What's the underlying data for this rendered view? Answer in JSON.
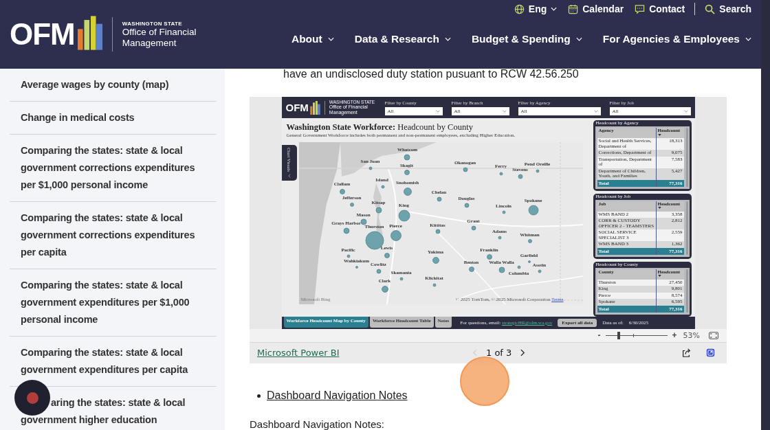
{
  "header": {
    "logo": {
      "letters": "OFM",
      "state": "WASHINGTON STATE",
      "line1": "Office of Financial",
      "line2": "Management"
    },
    "utility": [
      {
        "kind": "language",
        "label": "Eng",
        "caret": true
      },
      {
        "kind": "calendar",
        "label": "Calendar",
        "caret": false
      },
      {
        "kind": "contact",
        "label": "Contact",
        "caret": false
      },
      {
        "kind": "search",
        "label": "Search",
        "caret": false
      }
    ],
    "nav": [
      {
        "label": "About"
      },
      {
        "label": "Data & Research"
      },
      {
        "label": "Budget & Spending"
      },
      {
        "label": "For Agencies & Employees"
      }
    ]
  },
  "sidebar": {
    "items": [
      {
        "label": "Average wages by county (map)"
      },
      {
        "label": "Change in medical costs"
      },
      {
        "label": "Comparing the states: state & local government corrections expenditures per $1,000 personal income"
      },
      {
        "label": "Comparing the states: state & local government corrections expenditures per capita"
      },
      {
        "label": "Comparing the states: state & local government expenditures per $1,000 personal income"
      },
      {
        "label": "Comparing the states: state & local government expenditures per capita"
      },
      {
        "label": "aring the states: state & local government higher education"
      }
    ]
  },
  "main": {
    "intro": "have an undisclosed duty station pusuant to RCW 42.56.250",
    "report": {
      "logo": {
        "letters": "OFM",
        "state": "WASHINGTON STATE",
        "line1": "Office of Financial",
        "line2": "Management"
      },
      "filters": [
        {
          "label": "Filter by County",
          "value": "All"
        },
        {
          "label": "Filter by Branch",
          "value": "All"
        },
        {
          "label": "Filter by Agency",
          "value": "All"
        },
        {
          "label": "Filter by Job",
          "value": "All"
        }
      ],
      "title": "**Washington State Workforce:** Headcount by County",
      "subtitle": "General Government Workforce includes both permanent and non-permanent employees, excluding Higher Education.",
      "side_tab": "Chart Visuals",
      "map": {
        "counties": [
          "Whatcom",
          "San Juan",
          "Skagit",
          "Okanogan",
          "Ferry",
          "Stevens",
          "Pend Oreille",
          "Island",
          "Snohomish",
          "Clallam",
          "Jefferson",
          "Chelan",
          "Douglas",
          "Kitsap",
          "King",
          "Lincoln",
          "Spokane",
          "Mason",
          "Grays Harbor",
          "Thurston",
          "Pierce",
          "Grant",
          "Kittitas",
          "Adams",
          "Whitman",
          "Lewis",
          "Pacific",
          "Wahkiakum",
          "Cowlitz",
          "Yakima",
          "Franklin",
          "Benton",
          "Garfield",
          "Walla Walla",
          "Asotin",
          "Columbia",
          "Skamania",
          "Klickitat",
          "Clark"
        ],
        "bing": "Microsoft Bing",
        "attribution": "© 2025 TomTom, © 2025 Microsoft Corporation",
        "terms": "Terms"
      },
      "tables": [
        {
          "title": "Headcount by Agency",
          "columns": [
            "Agency",
            "Headcount"
          ],
          "rows": [
            [
              "Social and Health Services, Department of",
              "18,313"
            ],
            [
              "Corrections, Department of",
              "9,075"
            ],
            [
              "Transportation, Department of",
              "7,583"
            ],
            [
              "Department of Children, Youth, and Families",
              "5,427"
            ]
          ],
          "total": [
            "Total",
            "77,316"
          ]
        },
        {
          "title": "Headcount by Job",
          "columns": [
            "Job",
            "Headcount"
          ],
          "rows": [
            [
              "WMS BAND 2",
              "3,358"
            ],
            [
              "CORR & CUSTODY OFFICER 2 - TEAMSTERS",
              "2,812"
            ],
            [
              "SOCIAL SERVICE SPECIALIST 3",
              "2,559"
            ],
            [
              "WMS BAND 3",
              "1,362"
            ]
          ],
          "total": [
            "Total",
            "77,316"
          ]
        },
        {
          "title": "Headcount by County",
          "columns": [
            "County",
            "Headcount"
          ],
          "rows": [
            [
              "Thurston",
              "27,450"
            ],
            [
              "King",
              "9,801"
            ],
            [
              "Pierce",
              "8,574"
            ],
            [
              "Spokane",
              "6,595"
            ]
          ],
          "total": [
            "Total",
            "77,316"
          ]
        }
      ],
      "tabs": [
        {
          "label": "Workforce Headcount Map by County",
          "selected": true
        },
        {
          "label": "Workforce Headcount Table",
          "selected": false
        },
        {
          "label": "Notes",
          "selected": false
        }
      ],
      "contact": {
        "text": "For questions, email:",
        "email": "strategicHR@ofm.wa.gov"
      },
      "export": "Export all data",
      "as_of_label": "Data as of:",
      "as_of": "6/30/2025"
    },
    "viewer": {
      "minus": "-",
      "plus": "+",
      "level": 0.22,
      "percent": "53%",
      "brand": "Microsoft Power BI",
      "page": "1 of 3",
      "prev_disabled": true
    },
    "links": [
      {
        "label": "Dashboard Navigation Notes"
      }
    ],
    "heading": "Dashboard Navigation Notes:"
  }
}
